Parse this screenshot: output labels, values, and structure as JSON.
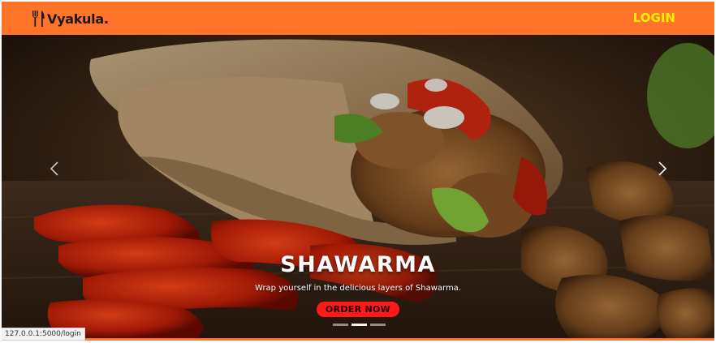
{
  "navbar": {
    "brand_name": "Vyakula.",
    "brand_icon": "fork-knife-icon",
    "login_label": "LOGIN",
    "background_color": "#ff7428",
    "login_color": "#fff200"
  },
  "carousel": {
    "slides_count": 3,
    "active_index": 1,
    "active_slide": {
      "title": "SHAWARMA",
      "subtitle": "Wrap yourself in the delicious layers of Shawarma.",
      "button_label": "ORDER NOW",
      "button_color": "#ff1a1a"
    },
    "prev_icon": "chevron-left-icon",
    "next_icon": "chevron-right-icon"
  },
  "status_bar": {
    "url": "127.0.0.1:5000/login"
  }
}
